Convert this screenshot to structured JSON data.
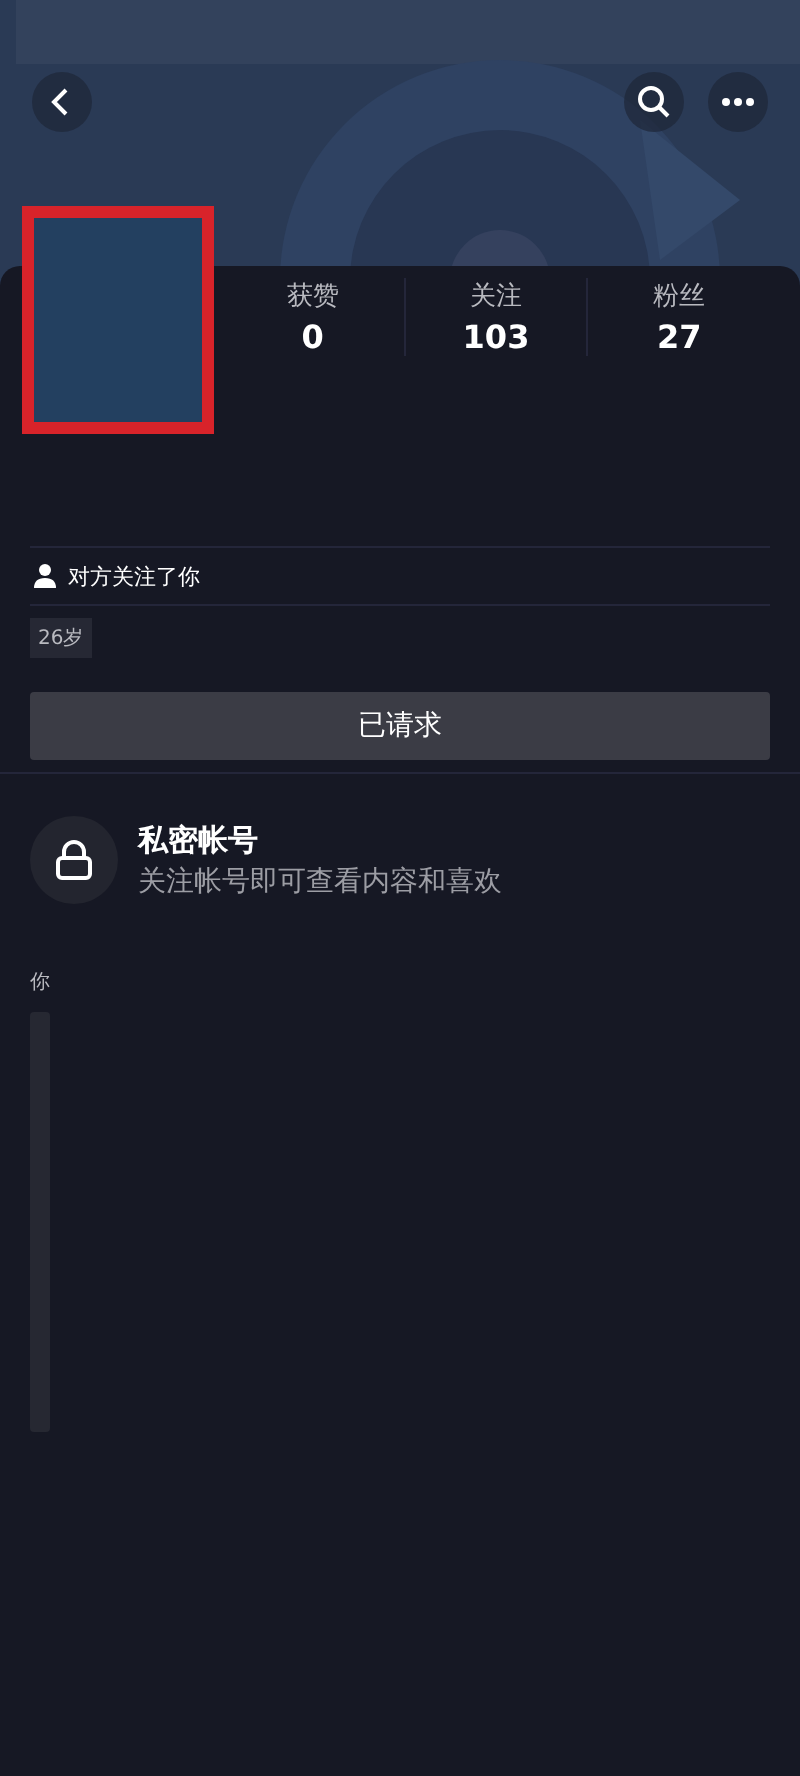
{
  "stats": [
    {
      "label": "获赞",
      "value": "0"
    },
    {
      "label": "关注",
      "value": "103"
    },
    {
      "label": "粉丝",
      "value": "27"
    }
  ],
  "relation": "对方关注了你",
  "age_tag": "26岁",
  "request_button": "已请求",
  "private": {
    "title": "私密帐号",
    "subtitle": "关注帐号即可查看内容和喜欢"
  },
  "section_label": "你"
}
